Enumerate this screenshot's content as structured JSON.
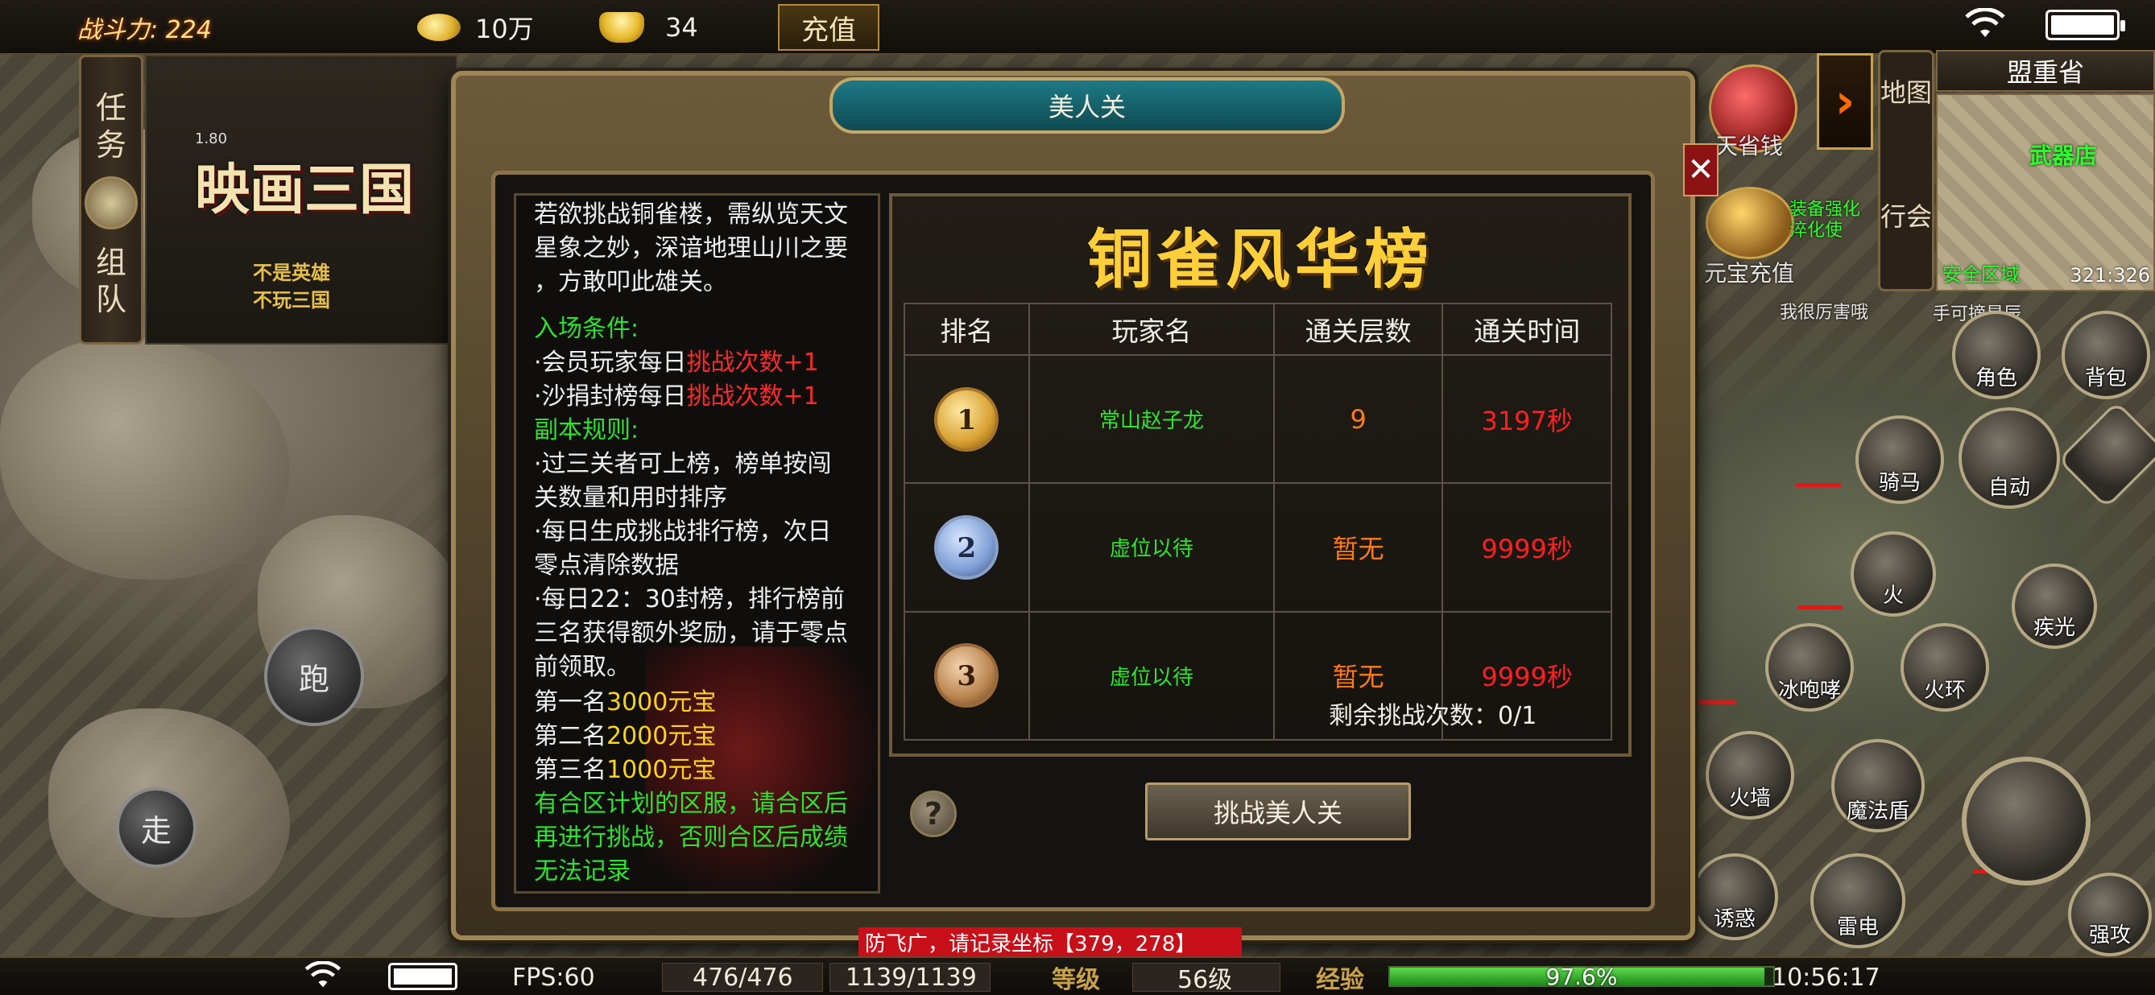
{
  "top_bar": {
    "power_label": "战斗力: 224",
    "gold_amount": "10万",
    "ingot_amount": "34",
    "recharge_label": "充值"
  },
  "left_tabs": {
    "task": "任务",
    "team": "组队"
  },
  "logo": {
    "version": "1.80",
    "title": "映画三国",
    "slogan_line1": "不是英雄",
    "slogan_line2": "不玩三国"
  },
  "movement": {
    "run": "跑",
    "walk": "走"
  },
  "dialog": {
    "title": "美人关",
    "close": "✕",
    "info": {
      "intro_lines": [
        "若欲挑战铜雀楼，需纵览天文",
        "星象之妙，深谙地理山川之要",
        "，方敢叩此雄关。"
      ],
      "entry_heading": "入场条件:",
      "entry_1_prefix": "·会员玩家每日",
      "entry_1_highlight": "挑战次数+1",
      "entry_2_prefix": "·沙捐封榜每日",
      "entry_2_highlight": "挑战次数+1",
      "rules_heading": "副本规则:",
      "rule_lines": [
        "·过三关者可上榜，榜单按闯",
        "关数量和用时排序",
        "·每日生成挑战排行榜，次日",
        "零点清除数据",
        "·每日22：30封榜，排行榜前",
        "三名获得额外奖励，请于零点",
        "前领取。"
      ],
      "reward_1_prefix": "第一名",
      "reward_1_value": "3000元宝",
      "reward_2_prefix": "第二名",
      "reward_2_value": "2000元宝",
      "reward_3_prefix": "第三名",
      "reward_3_value": "1000元宝",
      "merge_lines": [
        "有合区计划的区服，请合区后",
        "再进行挑战，否则合区后成绩",
        "无法记录"
      ]
    },
    "ranking": {
      "title": "铜雀风华榜",
      "headers": [
        "排名",
        "玩家名",
        "通关层数",
        "通关时间"
      ],
      "rows": [
        {
          "rank": "1",
          "player": "常山赵子龙",
          "floors": "9",
          "time": "3197秒"
        },
        {
          "rank": "2",
          "player": "虚位以待",
          "floors": "暂无",
          "time": "9999秒"
        },
        {
          "rank": "3",
          "player": "虚位以待",
          "floors": "暂无",
          "time": "9999秒"
        }
      ],
      "remaining_attempts": "剩余挑战次数：0/1"
    },
    "help_label": "?",
    "challenge_button": "挑战美人关"
  },
  "right_panel": {
    "map_tab": "地图",
    "chat_tab": "行会",
    "map_name": "盟重省",
    "minimap_shop": "武器店",
    "minimap_safe_zone": "安全区域",
    "minimap_coords": "321:326",
    "event_1": "天省钱",
    "event_2": "元宝充值",
    "npc_1": "我很厉害哦",
    "npc_2": "手可摘星辰",
    "npc_3": "装备强化\n淬化使",
    "skills": {
      "character": "角色",
      "bag": "背包",
      "mount": "骑马",
      "auto": "自动",
      "fire_1": "火",
      "ice": "冰咆哮",
      "fire_2": "火环",
      "light": "疾光",
      "wall": "火墙",
      "shield": "魔法盾",
      "thunder": "雷电",
      "lure": "诱惑",
      "strong": "强攻"
    }
  },
  "notice": "防飞广，请记录坐标【379，278】",
  "status_bar": {
    "fps": "FPS:60",
    "hp": "476/476",
    "mp": "1139/1139",
    "level_label": "等级",
    "level_value": "56级",
    "exp_label": "经验",
    "exp_value": "97.6%",
    "exp_fraction": 0.976,
    "clock": "10:56:17"
  }
}
